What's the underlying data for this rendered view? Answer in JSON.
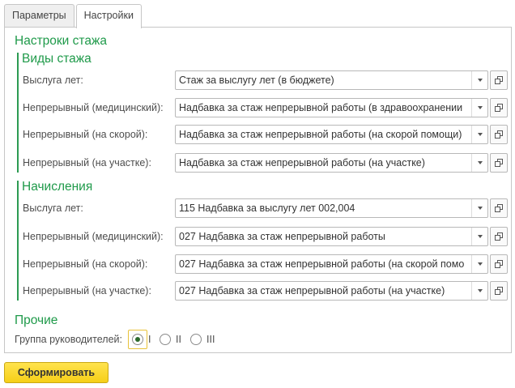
{
  "tabs": [
    {
      "label": "Параметры",
      "active": false
    },
    {
      "label": "Настройки",
      "active": true
    }
  ],
  "seniority_group": {
    "title": "Настроки стажа",
    "types": {
      "title": "Виды стажа",
      "rows": [
        {
          "label": "Выслуга лет:",
          "value": "Стаж за выслугу лет (в бюджете)"
        },
        {
          "label": "Непрерывный (медицинский):",
          "value": "Надбавка за стаж непрерывной работы (в здравоохранении"
        },
        {
          "label": "Непрерывный (на скорой):",
          "value": "Надбавка за стаж непрерывной работы (на скорой помощи)"
        },
        {
          "label": "Непрерывный (на участке):",
          "value": "Надбавка за стаж непрерывной работы (на участке)"
        }
      ]
    },
    "accruals": {
      "title": "Начисления",
      "rows": [
        {
          "label": "Выслуга лет:",
          "value": "115 Надбавка за выслугу лет 002,004"
        },
        {
          "label": "Непрерывный (медицинский):",
          "value": " 027 Надбавка за стаж непрерывной работы"
        },
        {
          "label": "Непрерывный (на скорой):",
          "value": "027 Надбавка за стаж непрерывной работы (на скорой помо"
        },
        {
          "label": "Непрерывный (на участке):",
          "value": "027 Надбавка за стаж непрерывной работы (на участке)"
        }
      ]
    }
  },
  "other_group": {
    "title": "Прочие",
    "managers_label": "Группа руководителей:",
    "options": [
      {
        "label": "I",
        "checked": true
      },
      {
        "label": "II",
        "checked": false
      },
      {
        "label": "III",
        "checked": false
      }
    ]
  },
  "submit_label": "Сформировать",
  "icons": {
    "dropdown": "chevron-down-icon",
    "open": "open-form-icon"
  },
  "colors": {
    "group_title": "#1f9a4a",
    "submit_bg": "#f6cf18"
  }
}
